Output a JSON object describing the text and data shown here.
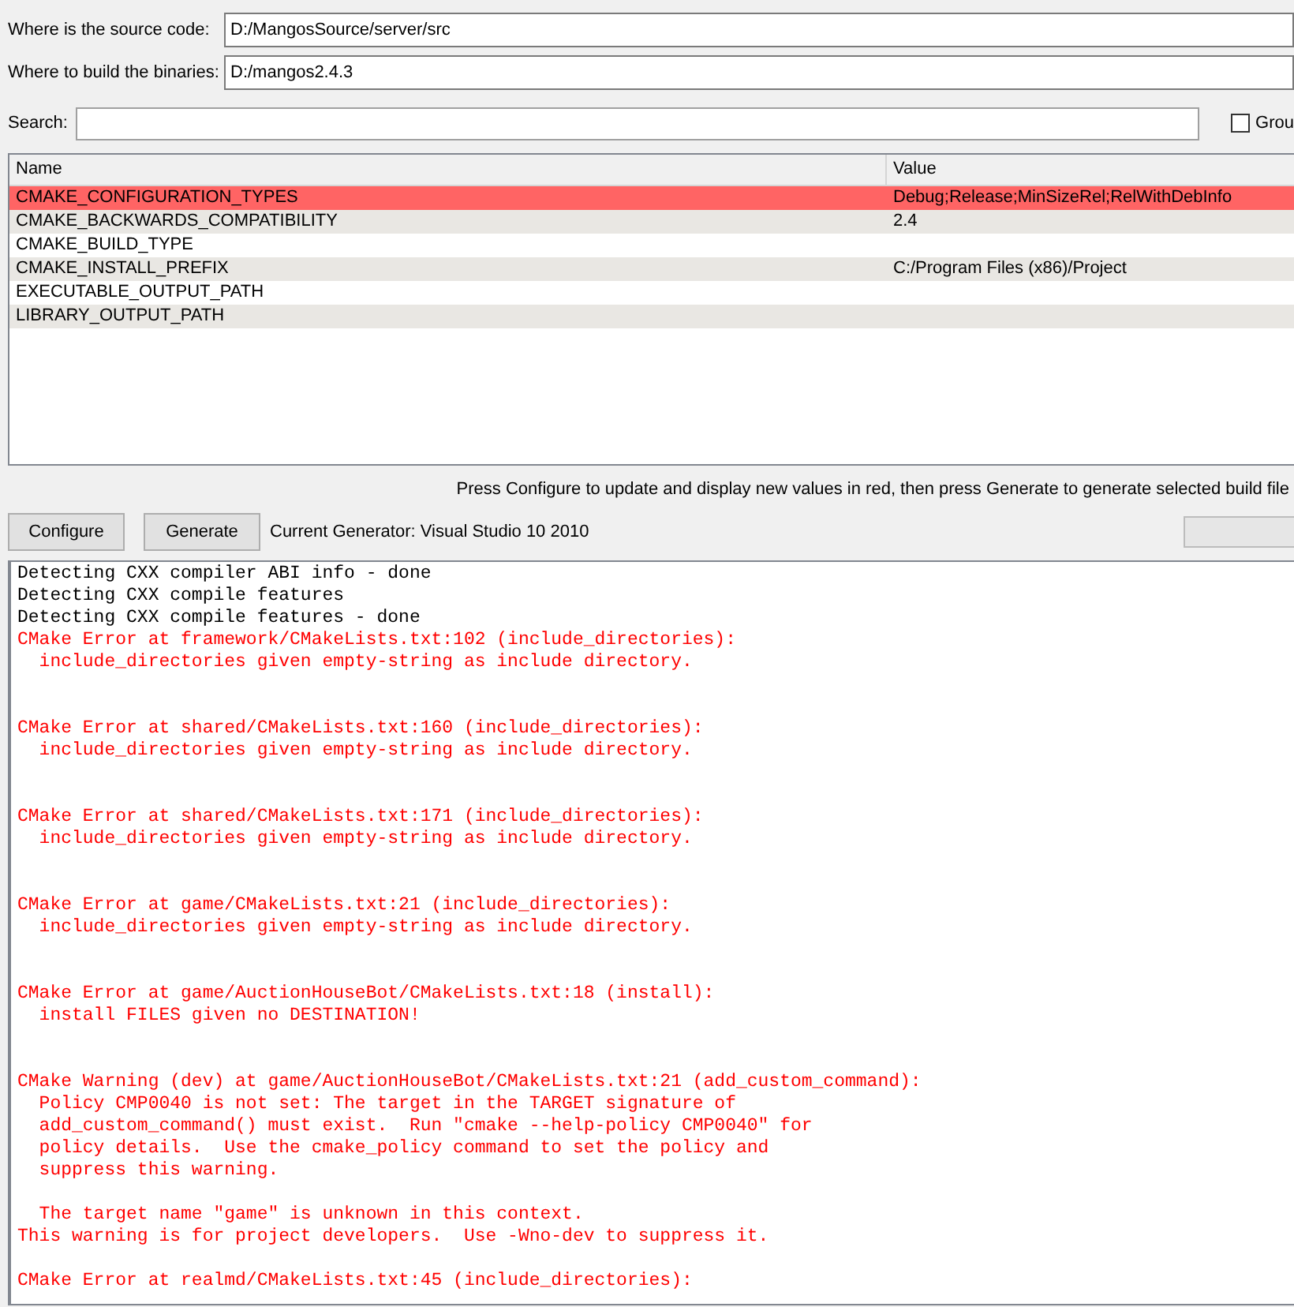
{
  "paths": [
    {
      "label": "Where is the source code:",
      "value": "D:/MangosSource/server/src"
    },
    {
      "label": "Where to build the binaries:",
      "value": "D:/mangos2.4.3"
    }
  ],
  "search": {
    "label": "Search:"
  },
  "grouped": {
    "label": "Grou",
    "checked": false
  },
  "table": {
    "columns": [
      "Name",
      "Value"
    ],
    "rows": [
      {
        "name": "CMAKE_CONFIGURATION_TYPES",
        "value": "Debug;Release;MinSizeRel;RelWithDebInfo",
        "new": true
      },
      {
        "name": "CMAKE_BACKWARDS_COMPATIBILITY",
        "value": "2.4",
        "new": false
      },
      {
        "name": "CMAKE_BUILD_TYPE",
        "new": false
      },
      {
        "name": "CMAKE_INSTALL_PREFIX",
        "value": "C:/Program Files (x86)/Project",
        "new": false
      },
      {
        "name": "EXECUTABLE_OUTPUT_PATH",
        "new": false
      },
      {
        "name": "LIBRARY_OUTPUT_PATH",
        "new": false
      }
    ]
  },
  "hint": "Press Configure to update and display new values in red, then press Generate to generate selected build file",
  "buttons": [
    "Configure",
    "Generate"
  ],
  "generator": "Current Generator: Visual Studio 10 2010",
  "progress": {
    "level": 0
  },
  "log": [
    {
      "kind": "status",
      "paragraphs": [
        [
          "Detecting CXX compiler ABI info - done",
          "Detecting CXX compile features",
          "Detecting CXX compile features - done"
        ]
      ]
    },
    {
      "kind": "error",
      "paragraphs": [
        [
          "CMake Error at framework/CMakeLists.txt:102 (include_directories):",
          "  include_directories given empty-string as include directory."
        ]
      ]
    },
    {
      "kind": "error",
      "paragraphs": [
        [
          "CMake Error at shared/CMakeLists.txt:160 (include_directories):",
          "  include_directories given empty-string as include directory."
        ]
      ]
    },
    {
      "kind": "error",
      "paragraphs": [
        [
          "CMake Error at shared/CMakeLists.txt:171 (include_directories):",
          "  include_directories given empty-string as include directory."
        ]
      ]
    },
    {
      "kind": "error",
      "paragraphs": [
        [
          "CMake Error at game/CMakeLists.txt:21 (include_directories):",
          "  include_directories given empty-string as include directory."
        ]
      ]
    },
    {
      "kind": "error",
      "paragraphs": [
        [
          "CMake Error at game/AuctionHouseBot/CMakeLists.txt:18 (install):",
          "  install FILES given no DESTINATION!"
        ]
      ]
    },
    {
      "kind": "warning",
      "paragraphs": [
        [
          "CMake Warning (dev) at game/AuctionHouseBot/CMakeLists.txt:21 (add_custom_command):",
          "  Policy CMP0040 is not set: The target in the TARGET signature of",
          "  add_custom_command() must exist.  Run \"cmake --help-policy CMP0040\" for",
          "  policy details.  Use the cmake_policy command to set the policy and",
          "  suppress this warning."
        ],
        [
          "  The target name \"game\" is unknown in this context.",
          "This warning is for project developers.  Use -Wno-dev to suppress it."
        ]
      ]
    },
    {
      "kind": "error",
      "paragraphs": [
        [
          "CMake Error at realmd/CMakeLists.txt:45 (include_directories):"
        ]
      ]
    }
  ]
}
